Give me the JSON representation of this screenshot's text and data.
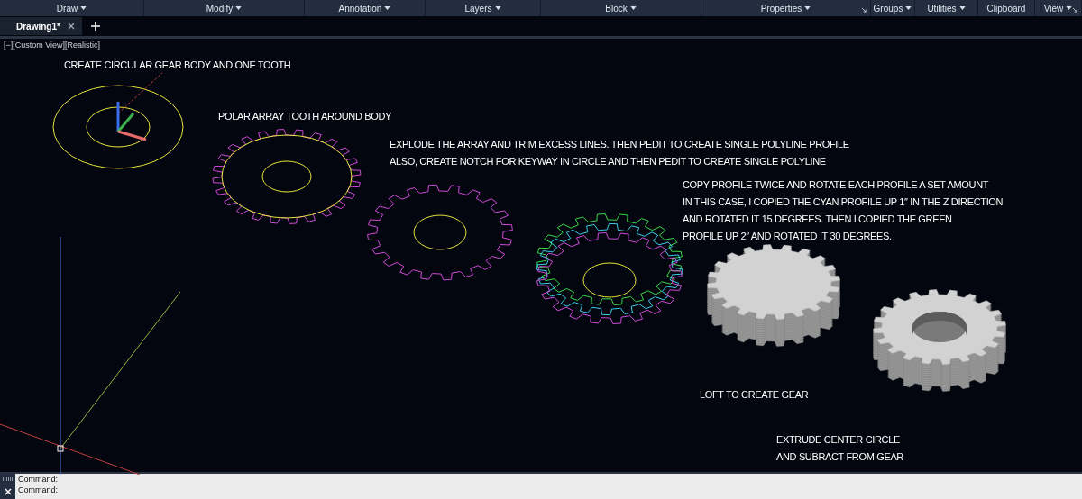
{
  "ribbon": {
    "panels": [
      {
        "label": "Draw",
        "dropdown": true,
        "launcher": false
      },
      {
        "label": "Modify",
        "dropdown": true,
        "launcher": false
      },
      {
        "label": "Annotation",
        "dropdown": true,
        "launcher": false
      },
      {
        "label": "Layers",
        "dropdown": true,
        "launcher": false
      },
      {
        "label": "Block",
        "dropdown": true,
        "launcher": false
      },
      {
        "label": "Properties",
        "dropdown": true,
        "launcher": true
      },
      {
        "label": "Groups",
        "dropdown": true,
        "launcher": false
      },
      {
        "label": "Utilities",
        "dropdown": true,
        "launcher": false
      },
      {
        "label": "Clipboard",
        "dropdown": false,
        "launcher": false
      },
      {
        "label": "View",
        "dropdown": true,
        "launcher": true
      }
    ]
  },
  "tabs": [
    {
      "label": "Drawing1*",
      "selected": true
    }
  ],
  "viewport_label": "[−][Custom View][Realistic]",
  "annotations": [
    {
      "lines": [
        "CREATE CIRCULAR GEAR BODY AND ONE TOOTH"
      ]
    },
    {
      "lines": [
        "POLAR ARRAY TOOTH AROUND BODY"
      ]
    },
    {
      "lines": [
        "EXPLODE THE ARRAY AND TRIM EXCESS LINES. THEN PEDIT TO CREATE SINGLE POLYLINE PROFILE",
        "ALSO, CREATE NOTCH FOR KEYWAY IN CIRCLE AND THEN PEDIT TO CREATE SINGLE POLYLINE"
      ]
    },
    {
      "lines": [
        "COPY PROFILE TWICE AND ROTATE EACH PROFILE A SET AMOUNT",
        "IN THIS CASE, I COPIED THE CYAN PROFILE UP 1″ IN THE Z DIRECTION",
        "AND ROTATED IT 15 DEGREES. THEN I COPIED THE GREEN",
        "PROFILE UP 2″ AND ROTATED IT 30 DEGREES."
      ]
    },
    {
      "lines": [
        "LOFT TO CREATE GEAR"
      ]
    },
    {
      "lines": [
        "EXTRUDE CENTER CIRCLE",
        "AND SUBRACT FROM GEAR"
      ]
    }
  ],
  "command_lines": [
    "Command:",
    "Command:"
  ]
}
